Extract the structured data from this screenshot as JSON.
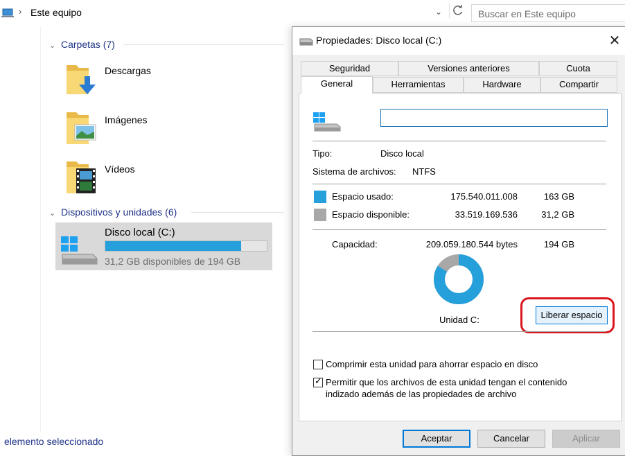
{
  "explorer": {
    "address": "Este equipo",
    "search_placeholder": "Buscar en Este equipo",
    "groups": {
      "folders_header": "Carpetas (7)",
      "devices_header": "Dispositivos y unidades (6)"
    },
    "folders": [
      {
        "label": "Descargas",
        "icon": "downloads-folder-icon"
      },
      {
        "label": "Imágenes",
        "icon": "pictures-folder-icon"
      },
      {
        "label": "Vídeos",
        "icon": "videos-folder-icon"
      }
    ],
    "drive": {
      "name": "Disco local (C:)",
      "free_text": "31,2 GB disponibles de 194 GB",
      "used_fraction": 0.84
    },
    "status": "elemento seleccionado"
  },
  "dialog": {
    "title": "Propiedades: Disco local (C:)",
    "close_label": "✕",
    "tabs_top": [
      "Seguridad",
      "Versiones anteriores",
      "Cuota"
    ],
    "tabs_bottom": [
      "General",
      "Herramientas",
      "Hardware",
      "Compartir"
    ],
    "active_tab": "General",
    "volume_name": "",
    "type_label": "Tipo:",
    "type_value": "Disco local",
    "fs_label": "Sistema de archivos:",
    "fs_value": "NTFS",
    "used_label": "Espacio usado:",
    "used_bytes": "175.540.011.008",
    "used_gb": "163 GB",
    "free_label": "Espacio disponible:",
    "free_bytes": "33.519.169.536",
    "free_gb": "31,2 GB",
    "capacity_label": "Capacidad:",
    "capacity_bytes": "209.059.180.544 bytes",
    "capacity_gb": "194 GB",
    "unit_label": "Unidad C:",
    "cleanup_button": "Liberar espacio",
    "compress_label": "Comprimir esta unidad para ahorrar espacio en disco",
    "compress_checked": false,
    "index_label_line1": "Permitir que los archivos de esta unidad tengan el contenido",
    "index_label_line2": "indizado además de las propiedades de archivo",
    "index_checked": true,
    "ok_button": "Aceptar",
    "cancel_button": "Cancelar",
    "apply_button": "Aplicar",
    "colors": {
      "used": "#26a0da",
      "free": "#a8a8a8",
      "highlight": "#d9151e"
    },
    "used_fraction": 0.84
  }
}
